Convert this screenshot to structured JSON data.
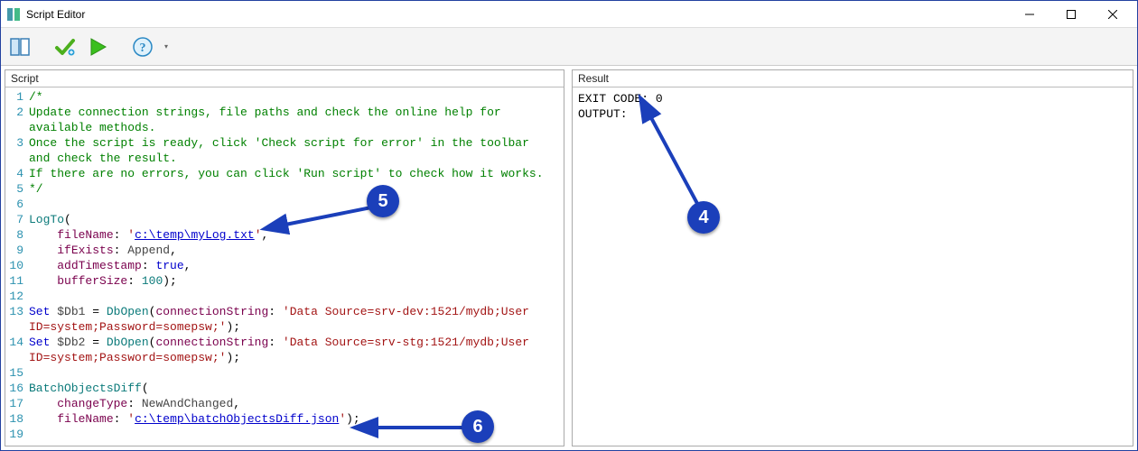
{
  "window": {
    "title": "Script Editor",
    "min_label": "Minimize",
    "max_label": "Maximize",
    "close_label": "Close"
  },
  "toolbar": {
    "toggle_label": "Toggle panel",
    "check_label": "Check script for error",
    "run_label": "Run script",
    "help_label": "Help",
    "overflow_label": "More"
  },
  "panel_left_title": "Script",
  "panel_right_title": "Result",
  "script_lines": [
    {
      "n": 1,
      "indent": 0,
      "tokens": [
        {
          "cls": "c-comment",
          "t": "/*"
        }
      ]
    },
    {
      "n": 2,
      "indent": 0,
      "tokens": [
        {
          "cls": "c-comment",
          "t": "Update connection strings, file paths and check the online help for available methods."
        }
      ]
    },
    {
      "n": 3,
      "indent": 0,
      "tokens": [
        {
          "cls": "c-comment",
          "t": "Once the script is ready, click 'Check script for error' in the toolbar and check the result."
        }
      ]
    },
    {
      "n": 4,
      "indent": 0,
      "tokens": [
        {
          "cls": "c-comment",
          "t": "If there are no errors, you can click 'Run script' to check how it works."
        }
      ]
    },
    {
      "n": 5,
      "indent": 0,
      "tokens": [
        {
          "cls": "c-comment",
          "t": "*/"
        }
      ]
    },
    {
      "n": 6,
      "indent": 0,
      "tokens": []
    },
    {
      "n": 7,
      "indent": 0,
      "tokens": [
        {
          "cls": "c-func",
          "t": "LogTo"
        },
        {
          "cls": "",
          "t": "("
        }
      ]
    },
    {
      "n": 8,
      "indent": 1,
      "tokens": [
        {
          "cls": "c-param",
          "t": "fileName"
        },
        {
          "cls": "",
          "t": ": "
        },
        {
          "cls": "c-string",
          "t": "'"
        },
        {
          "cls": "c-link",
          "t": "c:\\temp\\myLog.txt"
        },
        {
          "cls": "c-string",
          "t": "'"
        },
        {
          "cls": "",
          "t": ","
        }
      ]
    },
    {
      "n": 9,
      "indent": 1,
      "tokens": [
        {
          "cls": "c-param",
          "t": "ifExists"
        },
        {
          "cls": "",
          "t": ": "
        },
        {
          "cls": "c-ident",
          "t": "Append"
        },
        {
          "cls": "",
          "t": ","
        }
      ]
    },
    {
      "n": 10,
      "indent": 1,
      "tokens": [
        {
          "cls": "c-param",
          "t": "addTimestamp"
        },
        {
          "cls": "",
          "t": ": "
        },
        {
          "cls": "c-keyword",
          "t": "true"
        },
        {
          "cls": "",
          "t": ","
        }
      ]
    },
    {
      "n": 11,
      "indent": 1,
      "tokens": [
        {
          "cls": "c-param",
          "t": "bufferSize"
        },
        {
          "cls": "",
          "t": ": "
        },
        {
          "cls": "c-number",
          "t": "100"
        },
        {
          "cls": "",
          "t": ");"
        }
      ]
    },
    {
      "n": 12,
      "indent": 0,
      "tokens": []
    },
    {
      "n": 13,
      "indent": 0,
      "tokens": [
        {
          "cls": "c-keyword",
          "t": "Set"
        },
        {
          "cls": "",
          "t": " "
        },
        {
          "cls": "c-ident",
          "t": "$Db1"
        },
        {
          "cls": "",
          "t": " = "
        },
        {
          "cls": "c-func",
          "t": "DbOpen"
        },
        {
          "cls": "",
          "t": "("
        },
        {
          "cls": "c-param",
          "t": "connectionString"
        },
        {
          "cls": "",
          "t": ": "
        },
        {
          "cls": "c-string",
          "t": "'Data Source=srv-dev:1521/mydb;User ID=system;Password=somepsw;'"
        },
        {
          "cls": "",
          "t": ");"
        }
      ]
    },
    {
      "n": 14,
      "indent": 0,
      "tokens": [
        {
          "cls": "c-keyword",
          "t": "Set"
        },
        {
          "cls": "",
          "t": " "
        },
        {
          "cls": "c-ident",
          "t": "$Db2"
        },
        {
          "cls": "",
          "t": " = "
        },
        {
          "cls": "c-func",
          "t": "DbOpen"
        },
        {
          "cls": "",
          "t": "("
        },
        {
          "cls": "c-param",
          "t": "connectionString"
        },
        {
          "cls": "",
          "t": ": "
        },
        {
          "cls": "c-string",
          "t": "'Data Source=srv-stg:1521/mydb;User ID=system;Password=somepsw;'"
        },
        {
          "cls": "",
          "t": ");"
        }
      ]
    },
    {
      "n": 15,
      "indent": 0,
      "tokens": []
    },
    {
      "n": 16,
      "indent": 0,
      "tokens": [
        {
          "cls": "c-func",
          "t": "BatchObjectsDiff"
        },
        {
          "cls": "",
          "t": "("
        }
      ]
    },
    {
      "n": 17,
      "indent": 1,
      "tokens": [
        {
          "cls": "c-param",
          "t": "changeType"
        },
        {
          "cls": "",
          "t": ": "
        },
        {
          "cls": "c-ident",
          "t": "NewAndChanged"
        },
        {
          "cls": "",
          "t": ","
        }
      ]
    },
    {
      "n": 18,
      "indent": 1,
      "tokens": [
        {
          "cls": "c-param",
          "t": "fileName"
        },
        {
          "cls": "",
          "t": ": "
        },
        {
          "cls": "c-string",
          "t": "'"
        },
        {
          "cls": "c-link",
          "t": "c:\\temp\\batchObjectsDiff.json"
        },
        {
          "cls": "c-string",
          "t": "'"
        },
        {
          "cls": "",
          "t": ");"
        }
      ]
    },
    {
      "n": 19,
      "indent": 0,
      "tokens": []
    }
  ],
  "result_lines": [
    "EXIT CODE: 0",
    "OUTPUT:"
  ],
  "annotations": {
    "a4": "4",
    "a5": "5",
    "a6": "6"
  }
}
